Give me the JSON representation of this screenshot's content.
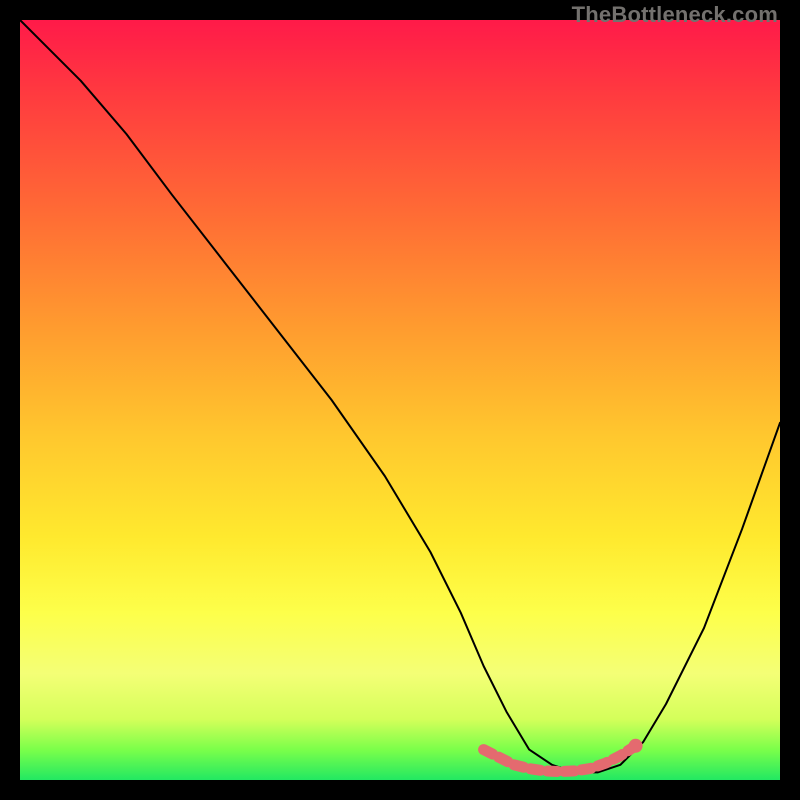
{
  "watermark": "TheBottleneck.com",
  "colors": {
    "frame": "#000000",
    "curve": "#000000",
    "marker_stroke": "#e46a6f",
    "marker_fill": "#e46a6f",
    "gradient_top": "#ff1a49",
    "gradient_bottom": "#22e862"
  },
  "chart_data": {
    "type": "line",
    "title": "",
    "subtitle": "",
    "xlabel": "",
    "ylabel": "",
    "xlim": [
      0,
      100
    ],
    "ylim": [
      0,
      100
    ],
    "grid": false,
    "legend": false,
    "annotations": [],
    "series": [
      {
        "name": "bottleneck-curve",
        "x": [
          0,
          3,
          8,
          14,
          20,
          27,
          34,
          41,
          48,
          54,
          58,
          61,
          64,
          67,
          70,
          73,
          76,
          79,
          82,
          85,
          90,
          95,
          100
        ],
        "y": [
          100,
          97,
          92,
          85,
          77,
          68,
          59,
          50,
          40,
          30,
          22,
          15,
          9,
          4,
          2,
          1,
          1,
          2,
          5,
          10,
          20,
          33,
          47
        ]
      }
    ],
    "markers": {
      "name": "highlight-range",
      "x": [
        61,
        63,
        65,
        67,
        69,
        71,
        73,
        75,
        77,
        79,
        81
      ],
      "y": [
        4,
        3,
        2,
        1.5,
        1.2,
        1.1,
        1.2,
        1.5,
        2.2,
        3.2,
        4.5
      ]
    }
  }
}
